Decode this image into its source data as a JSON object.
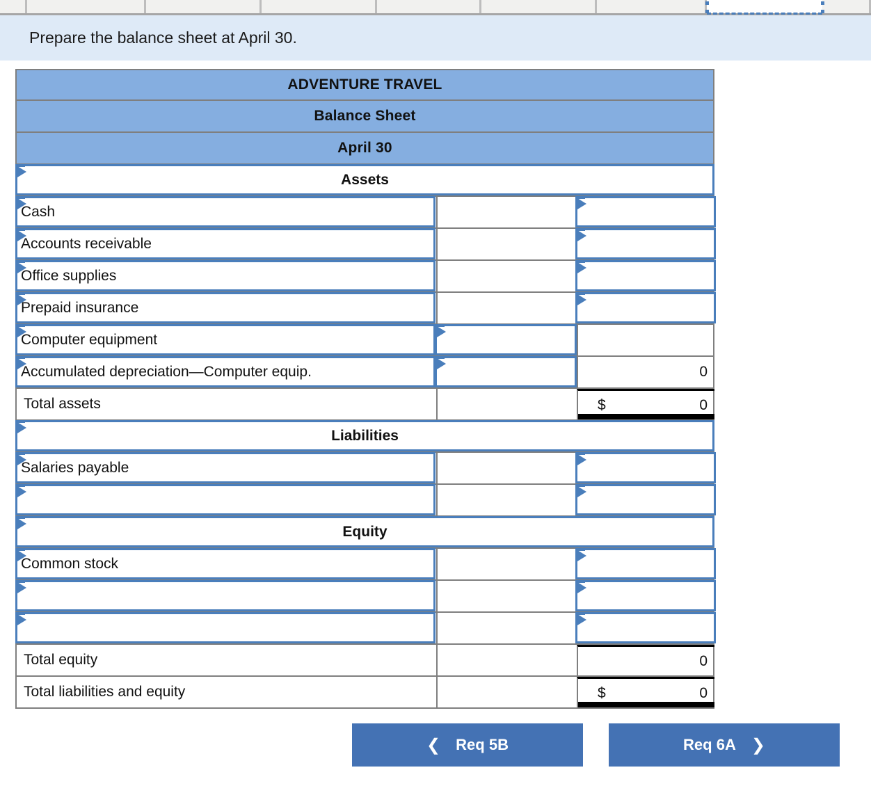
{
  "banner": {
    "instruction": "Prepare the balance sheet at April 30."
  },
  "spreadsheet_strip": {
    "selected_cell_value": ""
  },
  "sheet": {
    "company": "ADVENTURE TRAVEL",
    "statement": "Balance Sheet",
    "date": "April 30",
    "sections": {
      "assets": "Assets",
      "liabilities": "Liabilities",
      "equity": "Equity"
    },
    "rows": {
      "cash": {
        "label": "Cash",
        "mid": "",
        "right": ""
      },
      "accounts_receivable": {
        "label": "Accounts receivable",
        "mid": "",
        "right": ""
      },
      "office_supplies": {
        "label": "Office supplies",
        "mid": "",
        "right": ""
      },
      "prepaid_insurance": {
        "label": "Prepaid insurance",
        "mid": "",
        "right": ""
      },
      "computer_equipment": {
        "label": "Computer equipment",
        "mid": "",
        "right": ""
      },
      "accumulated_depreciation": {
        "label": "Accumulated depreciation—Computer equip.",
        "mid": "",
        "right": "0"
      },
      "total_assets": {
        "label": "Total assets",
        "mid": "",
        "currency": "$",
        "right": "0"
      },
      "salaries_payable": {
        "label": "Salaries payable",
        "mid": "",
        "right": ""
      },
      "liability_blank": {
        "label": "",
        "mid": "",
        "right": ""
      },
      "common_stock": {
        "label": "Common stock",
        "mid": "",
        "right": ""
      },
      "equity_blank_1": {
        "label": "",
        "mid": "",
        "right": ""
      },
      "equity_blank_2": {
        "label": "",
        "mid": "",
        "right": ""
      },
      "total_equity": {
        "label": "Total equity",
        "mid": "",
        "right": "0"
      },
      "total_liabilities_and_equity": {
        "label": "Total liabilities and equity",
        "mid": "",
        "currency": "$",
        "right": "0"
      }
    }
  },
  "nav": {
    "prev_label": "Req 5B",
    "prev_icon": "chevron-left-icon",
    "next_label": "Req 6A",
    "next_icon": "chevron-right-icon"
  },
  "colors": {
    "header_blue": "#85aee0",
    "banner_blue": "#deeaf7",
    "input_border_blue": "#4a7ebb",
    "button_blue": "#4472b4",
    "grid_gray": "#7f7f7f"
  }
}
